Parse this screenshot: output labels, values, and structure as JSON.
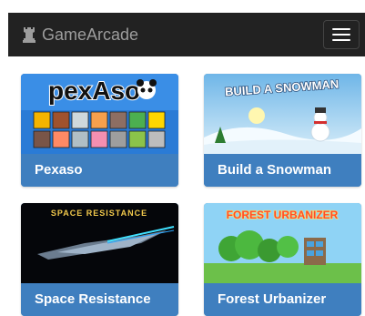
{
  "navbar": {
    "brand": "GameArcade",
    "brand_icon": "rook-icon",
    "toggle_icon": "hamburger-icon"
  },
  "games": [
    {
      "title": "Pexaso",
      "thumb_text": "pexAso"
    },
    {
      "title": "Build a Snowman",
      "thumb_text": "BUILD A SNOWMAN"
    },
    {
      "title": "Space Resistance",
      "thumb_text": "SPACE RESISTANCE"
    },
    {
      "title": "Forest Urbanizer",
      "thumb_text": "FOREST URBANIZER"
    }
  ],
  "colors": {
    "navbar_bg": "#222222",
    "caption_bg": "#3f7fbf",
    "caption_text": "#ffffff"
  }
}
